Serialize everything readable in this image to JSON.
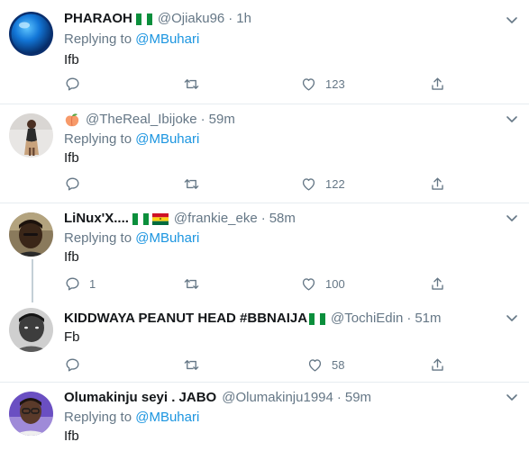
{
  "tweets": [
    {
      "name": "PHARAOH",
      "handle": "@Ojiaku96",
      "time": "1h",
      "replying_prefix": "Replying to",
      "replying_to": "@MBuhari",
      "text": "Ifb",
      "replies": "",
      "likes": "123",
      "flags": [
        "nigeria-flag"
      ],
      "avatar": "blue-orb-avatar"
    },
    {
      "name": "",
      "handle": "@TheReal_Ibijoke",
      "time": "59m",
      "replying_prefix": "Replying to",
      "replying_to": "@MBuhari",
      "text": "Ifb",
      "replies": "",
      "likes": "122",
      "flags": [
        "peach-emoji"
      ],
      "avatar": "woman-photo-avatar"
    },
    {
      "name": "LiNux'X....",
      "handle": "@frankie_eke",
      "time": "58m",
      "replying_prefix": "Replying to",
      "replying_to": "@MBuhari",
      "text": "Ifb",
      "replies": "1",
      "likes": "100",
      "flags": [
        "nigeria-flag",
        "ghana-flag"
      ],
      "avatar": "man-photo-avatar"
    },
    {
      "name": "KIDDWAYA PEANUT HEAD #BBNAIJA",
      "handle": "@TochiEdin",
      "time": "51m",
      "replying_prefix": "",
      "replying_to": "",
      "text": "Fb",
      "replies": "",
      "likes": "58",
      "flags": [
        "nigeria-flag"
      ],
      "avatar": "bw-photo-avatar"
    },
    {
      "name": "Olumakinju seyi . JABO",
      "handle": "@Olumakinju1994",
      "time": "59m",
      "replying_prefix": "Replying to",
      "replying_to": "@MBuhari",
      "text": "Ifb",
      "replies": "",
      "likes": "",
      "flags": [],
      "avatar": "man-purple-avatar"
    }
  ],
  "colors": {
    "accent": "#1b95e0",
    "muted": "#657786",
    "border": "#e6ecf0",
    "thread_line": "#c4cfd6"
  }
}
